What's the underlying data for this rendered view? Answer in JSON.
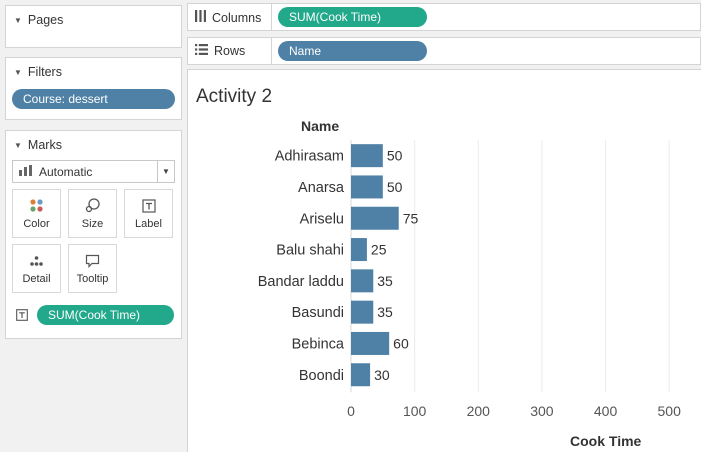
{
  "pages": {
    "title": "Pages"
  },
  "filters": {
    "title": "Filters",
    "pills": [
      "Course: dessert"
    ]
  },
  "marks": {
    "title": "Marks",
    "type_selected": "Automatic",
    "buttons": {
      "color": "Color",
      "size": "Size",
      "label": "Label",
      "detail": "Detail",
      "tooltip": "Tooltip"
    },
    "pill": "SUM(Cook Time)"
  },
  "columns": {
    "label": "Columns",
    "pill": "SUM(Cook Time)"
  },
  "rows": {
    "label": "Rows",
    "pill": "Name"
  },
  "view": {
    "title": "Activity 2",
    "row_header": "Name"
  },
  "colors": {
    "bar": "#4f81a7",
    "measure_pill": "#22a88a",
    "dimension_pill": "#4f81a7"
  },
  "chart_data": {
    "type": "bar",
    "orientation": "horizontal",
    "categories": [
      "Adhirasam",
      "Anarsa",
      "Ariselu",
      "Balu shahi",
      "Bandar laddu",
      "Basundi",
      "Bebinca",
      "Boondi"
    ],
    "values": [
      50,
      50,
      75,
      25,
      35,
      35,
      60,
      30
    ],
    "xlabel": "Cook Time",
    "ylabel": "Name",
    "xlim": [
      0,
      500
    ],
    "xticks": [
      0,
      100,
      200,
      300,
      400,
      500
    ],
    "data_labels": true,
    "grid": true
  }
}
